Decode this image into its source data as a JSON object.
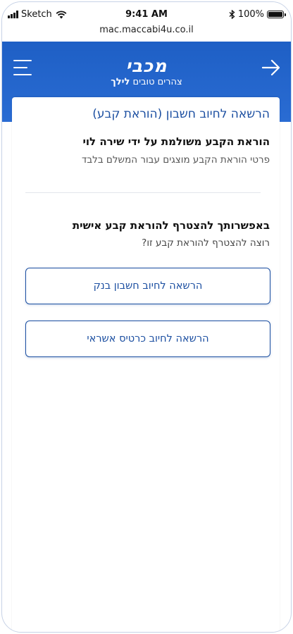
{
  "status_bar": {
    "carrier": "Sketch",
    "time": "9:41 AM",
    "battery": "100%"
  },
  "browser": {
    "url": "mac.maccabi4u.co.il"
  },
  "header": {
    "logo_text": "מכבי",
    "tagline_regular": "צהרים טובים",
    "tagline_name": "לילך",
    "bg_color": "#2563c9"
  },
  "page": {
    "title": "הרשאה לחיוב חשבון (הוראת קבע)",
    "subtitle": "הוראת הקבע משולמת על ידי שירה לוי",
    "description": "פרטי הוראת הקבע מוצגים עבור המשלם בלבד",
    "section_title": "באפשרותך להצטרף להוראת קבע אישית",
    "section_question": "רוצה להצטרף להוראת קבע זו?",
    "buttons": {
      "bank": "הרשאה לחיוב חשבון בנק",
      "credit": "הרשאה לחיוב כרטיס אשראי"
    }
  },
  "colors": {
    "accent": "#1c4fa1",
    "header": "#2563c9"
  },
  "icons": {
    "menu": "hamburger-menu-icon",
    "back": "arrow-right-icon",
    "wifi": "wifi-icon",
    "bluetooth": "bluetooth-icon",
    "battery": "battery-icon",
    "signal": "signal-bars-icon"
  }
}
